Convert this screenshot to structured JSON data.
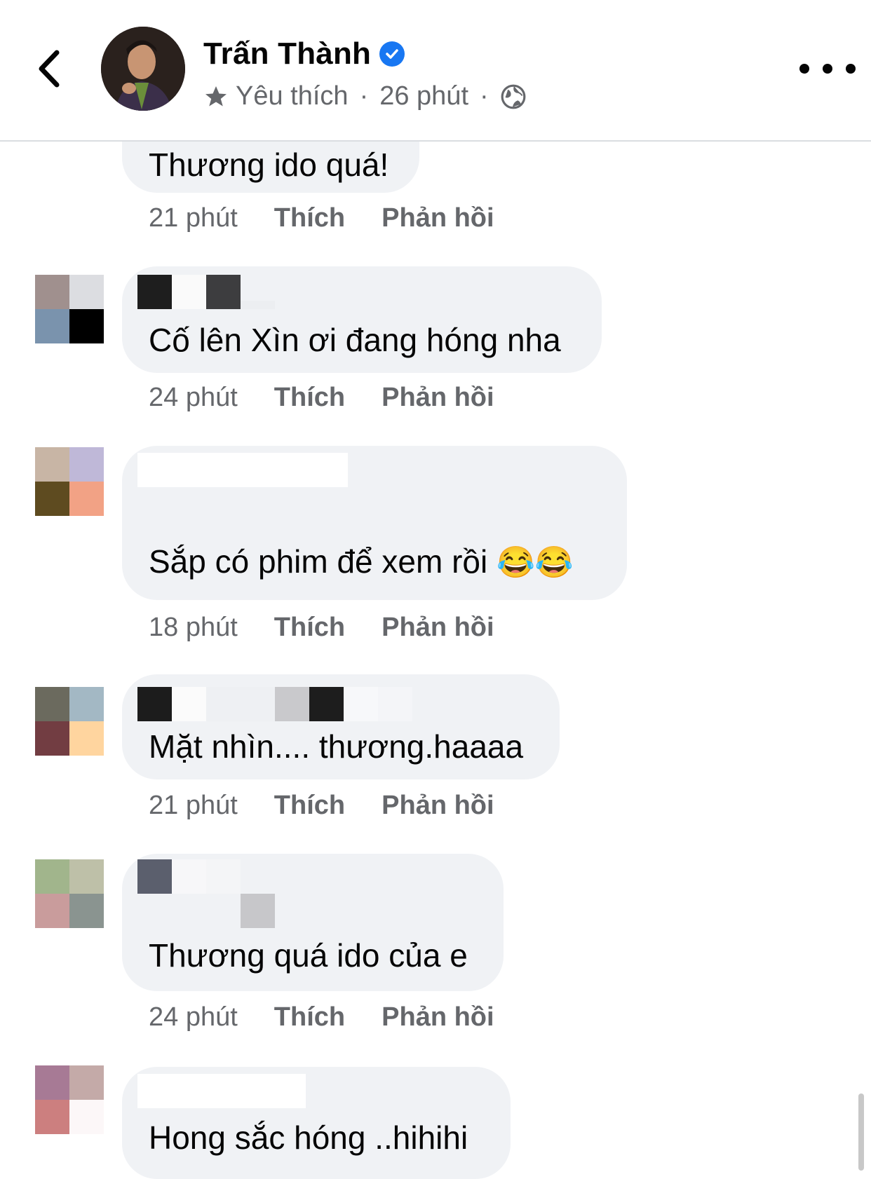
{
  "header": {
    "page_name": "Trấn Thành",
    "favorite_label": "Yêu thích",
    "separator": "·",
    "time": "26 phút",
    "separator2": "·"
  },
  "colors": {
    "accent": "#1877f2",
    "bubble": "#f0f2f5",
    "meta_text": "#65676b"
  },
  "actions": {
    "like": "Thích",
    "reply": "Phản hồi"
  },
  "comments": [
    {
      "text": "Thương ido quá!",
      "time": "21 phút"
    },
    {
      "text": "Cố lên Xìn ơi đang hóng nha",
      "time": "24 phút"
    },
    {
      "text": "Sắp có phim để xem rồi",
      "emoji": "😂😂",
      "time": "18 phút"
    },
    {
      "text": "Mặt nhìn.... thương.haaaa",
      "time": "21 phút"
    },
    {
      "text": "Thương quá ido của e",
      "time": "24 phút"
    },
    {
      "text": "Hong sắc hóng ..hihihi"
    }
  ]
}
